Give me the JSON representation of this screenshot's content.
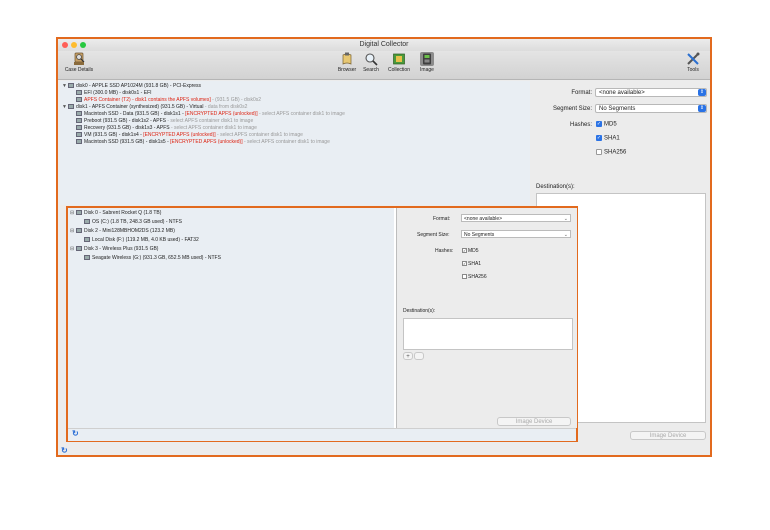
{
  "window": {
    "title": "Digital Collector",
    "accent": "#e26a1e"
  },
  "toolbar": {
    "case_details": "Case Details",
    "browser": "Browser",
    "search": "Search",
    "collection": "Collection",
    "image": "Image",
    "tools": "Tools"
  },
  "tree": [
    {
      "name": "disk0 - APPLE SSD AP1024M (931.8 GB) - PCI-Express",
      "extra": "",
      "extra2": ""
    },
    {
      "name": "EFI (300.0 MB) - disk0s1 - EFI",
      "extra": "",
      "extra2": ""
    },
    {
      "name": "",
      "extra": "APFS Container (T2) - disk1 contains the APFS volumes]",
      "extra2": " - (931.5 GB) - disk0s2"
    },
    {
      "name": "disk1 - APFS Container (synthesized) (931.5 GB) - Virtual",
      "extra": "",
      "extra2": " - data from disk0s2"
    },
    {
      "name": "Macintosh SSD - Data (931.5 GB) - disk1s1 - ",
      "extra": "[ENCRYPTED APFS (unlocked)]",
      "extra2": " - select APFS container disk1 to image"
    },
    {
      "name": "Preboot (931.5 GB) - disk1s2 - APFS",
      "extra": "",
      "extra2": " - select APFS container disk1 to image"
    },
    {
      "name": "Recovery (931.5 GB) - disk1s3 - APFS",
      "extra": "",
      "extra2": " - select APFS container disk1 to image"
    },
    {
      "name": "VM (931.5 GB) - disk1s4 - ",
      "extra": "[ENCRYPTED APFS (unlocked)]",
      "extra2": " - select APFS container disk1 to image"
    },
    {
      "name": "Macintosh SSD (931.5 GB) - disk1s5 - ",
      "extra": "[ENCRYPTED APFS (unlocked)]",
      "extra2": " - select APFS container disk1 to image"
    }
  ],
  "right": {
    "format_label": "Format:",
    "format_value": "<none available>",
    "segment_label": "Segment Size:",
    "segment_value": "No Segments",
    "hashes_label": "Hashes:",
    "md5": "MD5",
    "sha1": "SHA1",
    "sha256": "SHA256",
    "dest_label": "Destination(s):",
    "image_button": "Image Device"
  },
  "inner": {
    "tree": [
      "Disk 0 - Sabrent Rocket Q (1.8 TB)",
      "OS (C:) (1.8 TB, 248.3 GB used) - NTFS",
      "Disk 2 - Mini128MBHOM2DS (123.2 MB)",
      "Local Disk (F:) (119.2 MB, 4.0 KB used) - FAT32",
      "Disk 3 - Wireless Plus (931.5 GB)",
      "Seagate Wireless (G:) (931.3 GB, 652.5 MB used) - NTFS"
    ],
    "format_label": "Format:",
    "format_value": "<none available>",
    "segment_label": "Segment Size:",
    "segment_value": "No Segments",
    "hashes_label": "Hashes:",
    "md5": "MD5",
    "sha1": "SHA1",
    "sha256": "SHA256",
    "dest_label": "Destination(s):",
    "plus": "+",
    "image_button": "Image Device"
  }
}
